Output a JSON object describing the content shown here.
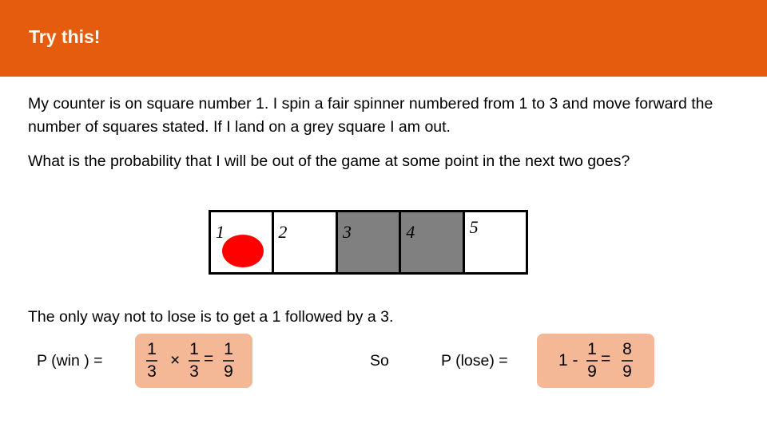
{
  "header": {
    "title": "Try this!",
    "background": "#e65c0f"
  },
  "problem": {
    "paragraph1": "My counter is on square number 1. I spin a fair spinner numbered from 1 to 3 and move forward the number of squares stated. If I land on a grey square I am out.",
    "paragraph2": "What is the probability that I will be out of the game at some point in the next two goes?"
  },
  "board": {
    "squares": [
      {
        "number": "1",
        "color": "white",
        "has_counter": true
      },
      {
        "number": "2",
        "color": "white",
        "has_counter": false
      },
      {
        "number": "3",
        "color": "grey",
        "has_counter": false
      },
      {
        "number": "4",
        "color": "grey",
        "has_counter": false
      },
      {
        "number": "5",
        "color": "white",
        "has_counter": false
      }
    ],
    "counter_color": "#ff0000"
  },
  "solution": {
    "explanation": "The only way not to lose is to get a 1 followed by a 3.",
    "win_label": "P (win ) =",
    "win_expression": {
      "frac1": {
        "num": "1",
        "den": "3"
      },
      "operator": "×",
      "frac2": {
        "num": "1",
        "den": "3"
      },
      "equals": "=",
      "result": {
        "num": "1",
        "den": "9"
      }
    },
    "so_label": "So",
    "lose_label": "P (lose) =",
    "lose_expression": {
      "lead": "1 -",
      "frac1": {
        "num": "1",
        "den": "9"
      },
      "equals": "=",
      "result": {
        "num": "8",
        "den": "9"
      }
    },
    "box_color": "#f4b896"
  }
}
